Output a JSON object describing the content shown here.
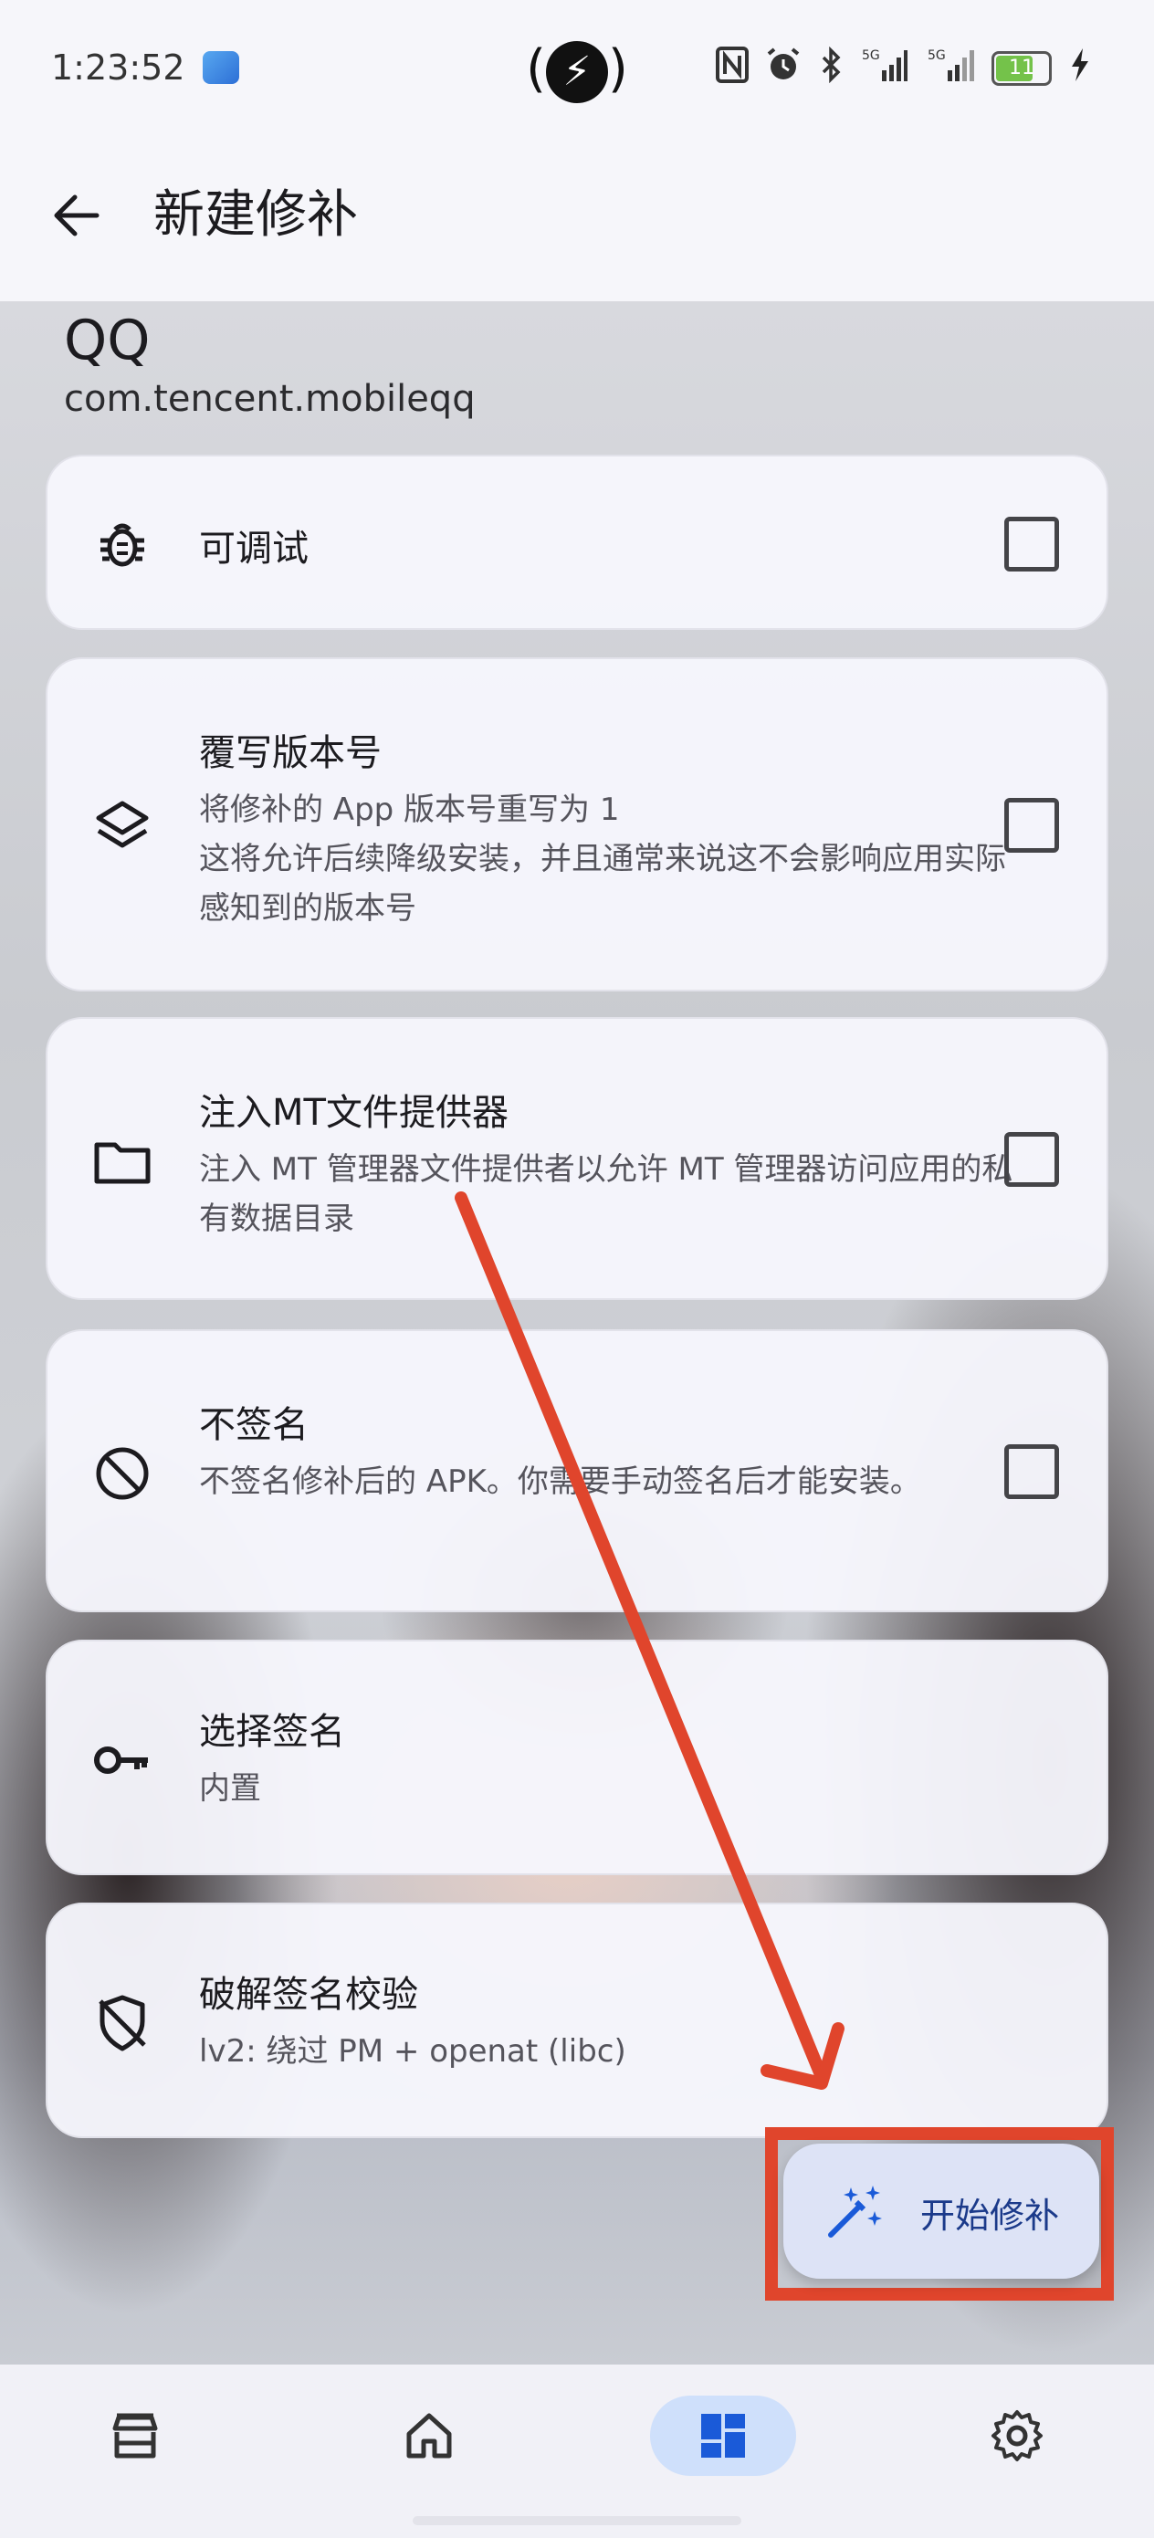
{
  "status_bar": {
    "time": "1:23:52",
    "battery_level": "11",
    "icons": [
      "gallery-icon",
      "charging-bolt-icon",
      "nfc-icon",
      "alarm-icon",
      "bluetooth-icon",
      "signal-5g-icon",
      "signal-5g-icon",
      "battery-icon",
      "charging-icon"
    ]
  },
  "header": {
    "title": "新建修补"
  },
  "app": {
    "name": "QQ",
    "package": "com.tencent.mobileqq"
  },
  "options": [
    {
      "icon": "bug-icon",
      "title": "可调试",
      "desc": "",
      "checked": false
    },
    {
      "icon": "layers-icon",
      "title": "覆写版本号",
      "desc": "将修补的 App 版本号重写为 1\n这将允许后续降级安装，并且通常来说这不会影响应用实际感知到的版本号",
      "checked": false
    },
    {
      "icon": "folder-icon",
      "title": "注入MT文件提供器",
      "desc": "注入 MT 管理器文件提供者以允许 MT 管理器访问应用的私有数据目录",
      "checked": false
    },
    {
      "icon": "block-icon",
      "title": "不签名",
      "desc": "不签名修补后的 APK。你需要手动签名后才能安装。",
      "checked": false
    },
    {
      "icon": "key-icon",
      "title": "选择签名",
      "desc": "内置"
    },
    {
      "icon": "shield-off-icon",
      "title": "破解签名校验",
      "desc": "lv2: 绕过 PM + openat (libc)"
    }
  ],
  "fab": {
    "label": "开始修补",
    "icon": "magic-wand-icon"
  },
  "bottom_nav": {
    "items": [
      {
        "icon": "store-icon",
        "active": false
      },
      {
        "icon": "home-icon",
        "active": false
      },
      {
        "icon": "dashboard-icon",
        "active": true
      },
      {
        "icon": "settings-icon",
        "active": false
      }
    ]
  },
  "colors": {
    "accent": "#1a5ad8",
    "annotation": "#e0452c",
    "fab_bg": "#dde3f6",
    "nav_active": "#cfe0fb"
  }
}
